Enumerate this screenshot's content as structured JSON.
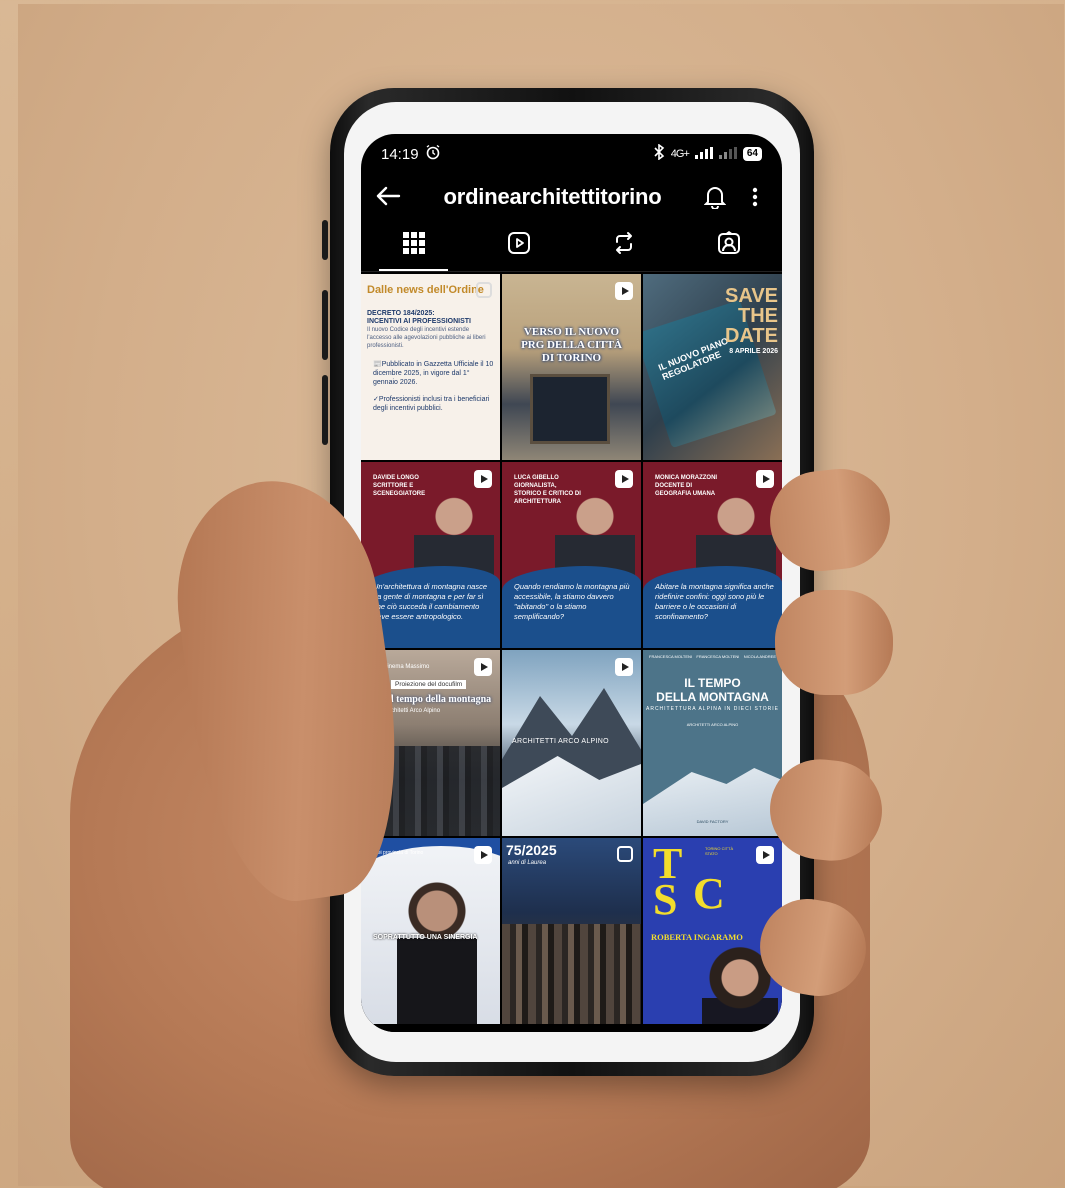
{
  "status_bar": {
    "time": "14:19",
    "alarm_icon": "alarm-icon",
    "bluetooth_icon": "bluetooth-icon",
    "network": "4G+",
    "battery": "64"
  },
  "header": {
    "username": "ordinearchitettitorino",
    "back_icon": "arrow-left-icon",
    "bell_icon": "bell-icon",
    "more_icon": "more-vertical-icon"
  },
  "tabs": [
    {
      "name": "grid",
      "icon": "grid-icon",
      "active": true
    },
    {
      "name": "reels",
      "icon": "reels-icon",
      "active": false
    },
    {
      "name": "reposts",
      "icon": "repost-icon",
      "active": false
    },
    {
      "name": "tagged",
      "icon": "tagged-icon",
      "active": false
    }
  ],
  "posts": {
    "p1": {
      "title": "Dalle news dell'Ordine",
      "head1": "Decreto 184/2025:",
      "head2": "Incentivi ai professionisti",
      "body": "Il nuovo Codice degli incentivi estende l'accesso alle agevolazioni pubbliche ai liberi professionisti.",
      "item1": "📰Pubblicato in Gazzetta Ufficiale il 10 dicembre 2025, in vigore dal 1° gennaio 2026.",
      "item2": "✓Professionisti inclusi tra i beneficiari degli incentivi pubblici."
    },
    "p2": {
      "line1": "VERSO IL NUOVO",
      "line2": "PRG DELLA CITTÀ",
      "line3": "DI TORINO"
    },
    "p3": {
      "save": "SAVE",
      "the": "THE",
      "date": "DATE",
      "when": "8 APRILE 2026",
      "book_text": "IL NUOVO PIANO REGOLATORE"
    },
    "p4": {
      "name": "Davide Longo",
      "role": "Scrittore e sceneggiatore",
      "quote": "Un'architettura di montagna nasce da gente di montagna e per far sì che ciò succeda il cambiamento deve essere antropologico."
    },
    "p5": {
      "name": "Luca Gibello",
      "role": "Giornalista, storico e critico di architettura",
      "quote": "Quando rendiamo la montagna più accessibile, la stiamo davvero \"abitando\" o la stiamo semplificando?"
    },
    "p6": {
      "name": "Monica Morazzoni",
      "role": "Docente di Geografia Umana",
      "quote": "Abitare la montagna significa anche ridefinire confini: oggi sono più le barriere o le occasioni di sconfinamento?"
    },
    "p7": {
      "cap": "Cinema Massimo",
      "tag": "Proiezione del docufilm",
      "title": "Il tempo della montagna",
      "sub": "Architetti Arco Alpino"
    },
    "p8": {
      "label": "ARCHITETTI ARCO ALPINO"
    },
    "p9": {
      "top_left": "FRANCESCA MOLTENI",
      "top_mid": "FRANCESCA MOLTENI",
      "top_right": "NICOLA ANDREE",
      "t1": "IL TEMPO",
      "t2": "DELLA MONTAGNA",
      "sub": "ARCHITETTURA ALPINA IN DIECI STORIE",
      "sub2": "ARCHITETTI ARCO ALPINO",
      "credit": "DAVID FACTORY"
    },
    "p10": {
      "top": "dei provincia di Torino",
      "caption": "SOPRATTUTTO UNA SINERGIA"
    },
    "p11": {
      "year": "75/2025",
      "line": "anni di Laurea"
    },
    "p12": {
      "l1": "T",
      "l2": "C",
      "l3": "S",
      "mini": "TORINO CITTÀ STATO",
      "name": "ROBERTA INGARAMO"
    }
  }
}
